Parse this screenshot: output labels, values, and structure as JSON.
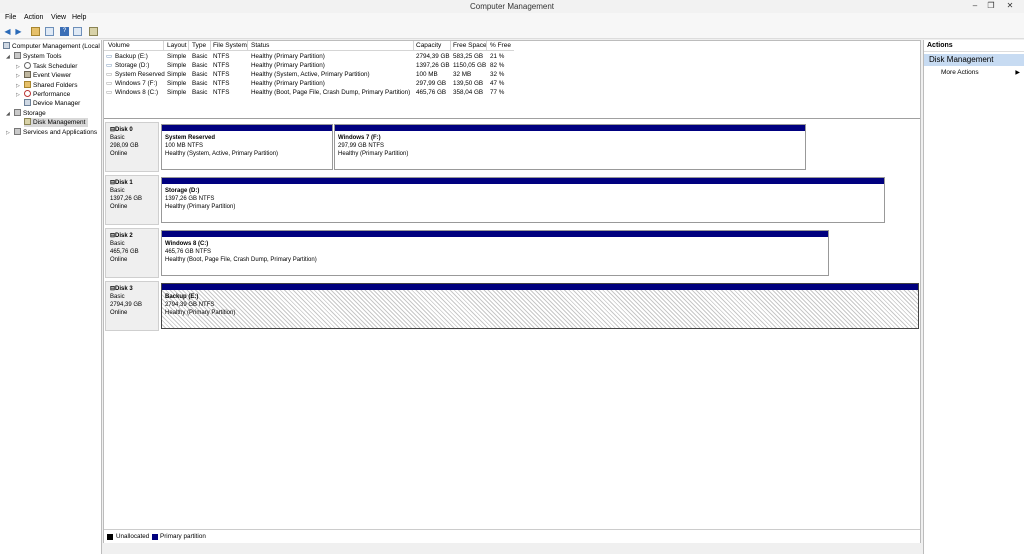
{
  "window": {
    "title": "Computer Management",
    "minimize": "–",
    "maximize": "❐",
    "close": "✕"
  },
  "menu": [
    "File",
    "Action",
    "View",
    "Help"
  ],
  "tree": {
    "root": "Computer Management (Local",
    "system_tools": "System Tools",
    "task_scheduler": "Task Scheduler",
    "event_viewer": "Event Viewer",
    "shared_folders": "Shared Folders",
    "performance": "Performance",
    "device_manager": "Device Manager",
    "storage": "Storage",
    "disk_management": "Disk Management",
    "services": "Services and Applications"
  },
  "volume_list": {
    "headers": [
      "Volume",
      "Layout",
      "Type",
      "File System",
      "Status",
      "Capacity",
      "Free Space",
      "% Free"
    ],
    "rows": [
      [
        "Backup (E:)",
        "Simple",
        "Basic",
        "NTFS",
        "Healthy (Primary Partition)",
        "2794,39 GB",
        "583,25 GB",
        "21 %"
      ],
      [
        "Storage (D:)",
        "Simple",
        "Basic",
        "NTFS",
        "Healthy (Primary Partition)",
        "1397,26 GB",
        "1150,05 GB",
        "82 %"
      ],
      [
        "System Reserved",
        "Simple",
        "Basic",
        "NTFS",
        "Healthy (System, Active, Primary Partition)",
        "100 MB",
        "32 MB",
        "32 %"
      ],
      [
        "Windows 7 (F:)",
        "Simple",
        "Basic",
        "NTFS",
        "Healthy (Primary Partition)",
        "297,99 GB",
        "139,50 GB",
        "47 %"
      ],
      [
        "Windows 8 (C:)",
        "Simple",
        "Basic",
        "NTFS",
        "Healthy (Boot, Page File, Crash Dump, Primary Partition)",
        "465,76 GB",
        "358,04 GB",
        "77 %"
      ]
    ]
  },
  "disks": [
    {
      "name": "Disk 0",
      "type": "Basic",
      "size": "298,09 GB",
      "state": "Online",
      "partitions": [
        {
          "name": "System Reserved",
          "size": "100 MB NTFS",
          "status": "Healthy (System, Active, Primary Partition)"
        },
        {
          "name": "Windows 7  (F:)",
          "size": "297,99 GB NTFS",
          "status": "Healthy (Primary Partition)"
        }
      ]
    },
    {
      "name": "Disk 1",
      "type": "Basic",
      "size": "1397,26 GB",
      "state": "Online",
      "partitions": [
        {
          "name": "Storage  (D:)",
          "size": "1397,26 GB NTFS",
          "status": "Healthy (Primary Partition)"
        }
      ]
    },
    {
      "name": "Disk 2",
      "type": "Basic",
      "size": "465,76 GB",
      "state": "Online",
      "partitions": [
        {
          "name": "Windows 8  (C:)",
          "size": "465,76 GB NTFS",
          "status": "Healthy (Boot, Page File, Crash Dump, Primary Partition)"
        }
      ]
    },
    {
      "name": "Disk 3",
      "type": "Basic",
      "size": "2794,39 GB",
      "state": "Online",
      "partitions": [
        {
          "name": "Backup  (E:)",
          "size": "2794,39 GB NTFS",
          "status": "Healthy (Primary Partition)"
        }
      ]
    }
  ],
  "legend": {
    "unallocated": "Unallocated",
    "primary": "Primary partition",
    "colors": {
      "unallocated": "#000000",
      "primary": "#00007f"
    }
  },
  "actions": {
    "header": "Actions",
    "section": "Disk Management",
    "more": "More Actions",
    "arrow": "▶"
  },
  "icons": {
    "disk": "⊟",
    "tree_expand": "▷",
    "tree_collapse": "◢"
  }
}
